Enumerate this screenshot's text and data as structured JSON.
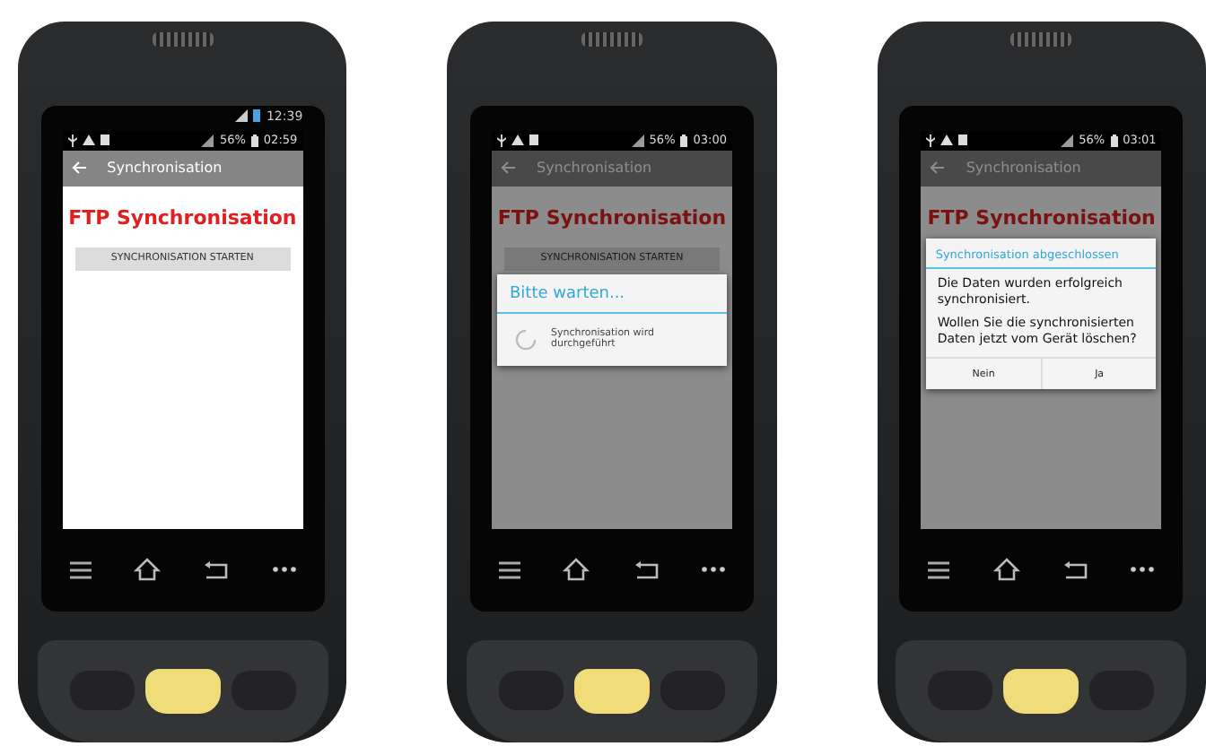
{
  "devices": [
    {
      "outer_status": {
        "time": "12:39"
      },
      "screen": {
        "status": {
          "battery": "56%",
          "time": "02:59"
        },
        "app_bar": {
          "title": "Synchronisation"
        },
        "heading": "FTP Synchronisation",
        "button": "SYNCHRONISATION STARTEN",
        "dimmed": false
      }
    },
    {
      "screen": {
        "status": {
          "battery": "56%",
          "time": "03:00"
        },
        "app_bar": {
          "title": "Synchronisation"
        },
        "heading": "FTP Synchronisation",
        "button": "SYNCHRONISATION STARTEN",
        "dimmed": true,
        "dialog": {
          "kind": "progress",
          "title": "Bitte warten...",
          "message": "Synchronisation wird durchgeführt"
        }
      }
    },
    {
      "screen": {
        "status": {
          "battery": "56%",
          "time": "03:01"
        },
        "app_bar": {
          "title": "Synchronisation"
        },
        "heading": "FTP Synchronisation",
        "dimmed": true,
        "dialog": {
          "kind": "confirm",
          "title": "Synchronisation abgeschlossen",
          "paragraphs": [
            "Die Daten wurden erfolgreich synchronisiert.",
            "Wollen Sie die synchronisierten Daten jetzt vom Gerät löschen?"
          ],
          "buttons": [
            "Nein",
            "Ja"
          ]
        }
      }
    }
  ]
}
